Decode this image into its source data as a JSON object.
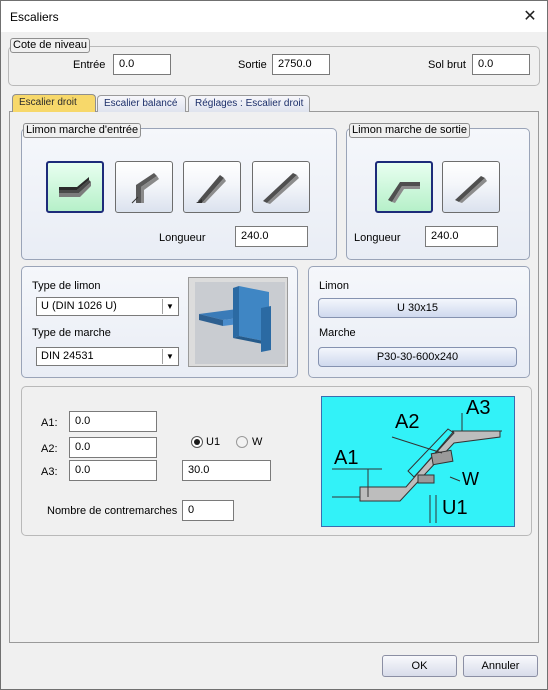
{
  "window": {
    "title": "Escaliers",
    "close_icon": "close-icon"
  },
  "cote_niveau": {
    "legend": "Cote de niveau",
    "entree_label": "Entrée",
    "entree_value": "0.0",
    "sortie_label": "Sortie",
    "sortie_value": "2750.0",
    "sol_brut_label": "Sol brut",
    "sol_brut_value": "0.0"
  },
  "tabs": [
    {
      "label": "Escalier droit",
      "active": true
    },
    {
      "label": "Escalier balancé",
      "active": false
    },
    {
      "label": "Réglages : Escalier droit",
      "active": false
    }
  ],
  "limon_entree": {
    "legend": "Limon marche d'entrée",
    "longueur_label": "Longueur",
    "longueur_value": "240.0",
    "icons": [
      "stringer-flat-entry-icon",
      "stringer-knee-entry-icon",
      "stringer-angled-entry-icon",
      "stringer-straight-entry-icon"
    ]
  },
  "limon_sortie": {
    "legend": "Limon marche de sortie",
    "longueur_label": "Longueur",
    "longueur_value": "240.0",
    "icons": [
      "stringer-flat-exit-icon",
      "stringer-straight-exit-icon"
    ]
  },
  "profil": {
    "type_limon_label": "Type de limon",
    "type_limon_value": "U (DIN 1026 U)",
    "type_marche_label": "Type de marche",
    "type_marche_value": "DIN 24531"
  },
  "selection": {
    "limon_label": "Limon",
    "limon_value": "U 30x15",
    "marche_label": "Marche",
    "marche_value": "P30-30-600x240"
  },
  "dims": {
    "a1_label": "A1:",
    "a1_value": "0.0",
    "a2_label": "A2:",
    "a2_value": "0.0",
    "a3_label": "A3:",
    "a3_value": "0.0",
    "u1_label": "U1",
    "w_label": "W",
    "extra_value": "30.0",
    "contremarches_label": "Nombre de contremarches",
    "contremarches_value": "0",
    "diagram_labels": {
      "a1": "A1",
      "a2": "A2",
      "a3": "A3",
      "w": "W",
      "u1": "U1"
    }
  },
  "buttons": {
    "ok": "OK",
    "annuler": "Annuler"
  },
  "colors": {
    "active_tab": "#f7d86a",
    "selected_icon": "#b6f0c9",
    "diagram_bg": "#32f2f8"
  }
}
